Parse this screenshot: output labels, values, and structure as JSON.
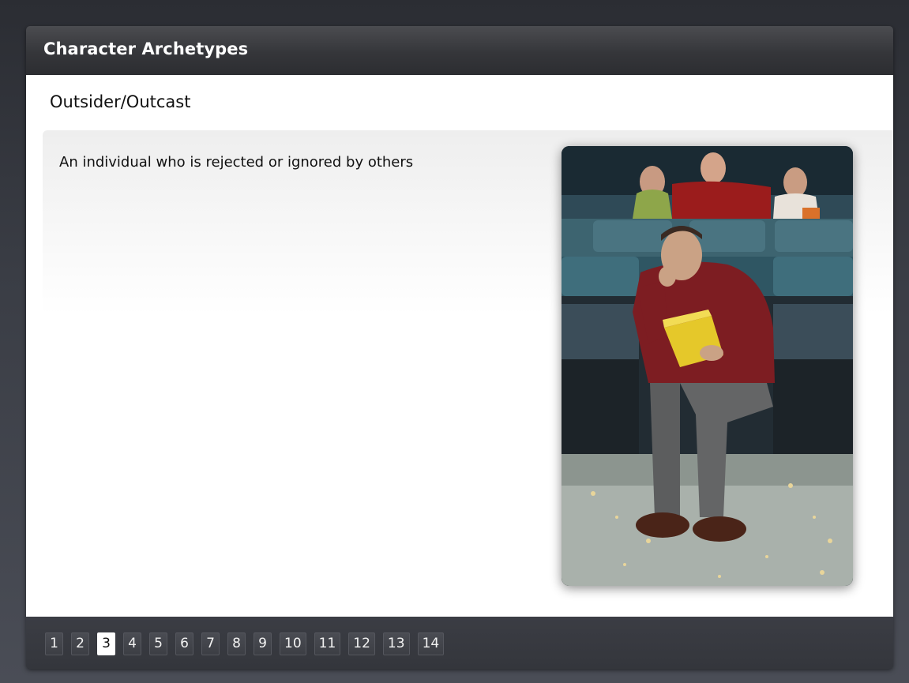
{
  "header": {
    "title": "Character Archetypes"
  },
  "slide": {
    "heading": "Outsider/Outcast",
    "description": "An individual who is rejected or ignored by others"
  },
  "navigation": {
    "current_page": "3",
    "pages": [
      "1",
      "2",
      "3",
      "4",
      "5",
      "6",
      "7",
      "8",
      "9",
      "10",
      "11",
      "12",
      "13",
      "14"
    ]
  },
  "colors": {
    "titlebar": "#35363a",
    "navbar": "#34363c",
    "active_page": "#ffffff"
  }
}
